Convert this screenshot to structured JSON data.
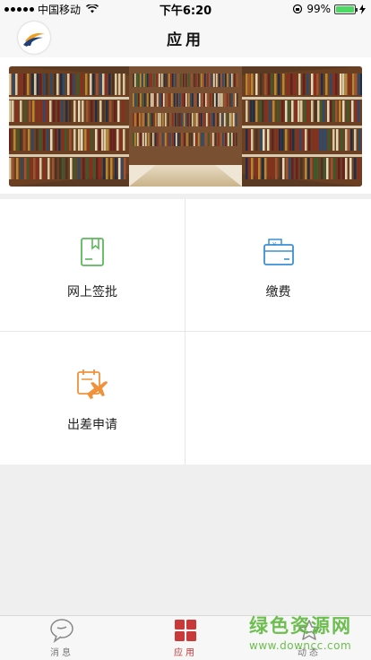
{
  "status_bar": {
    "carrier": "中国移动",
    "time": "下午6:20",
    "battery_percent": "99%",
    "battery_level": 0.99
  },
  "nav": {
    "title": "应用"
  },
  "apps": [
    {
      "label": "网上签批",
      "icon": "bookmark-document-icon",
      "color": "#5cb85c"
    },
    {
      "label": "缴费",
      "icon": "wallet-icon",
      "color": "#3a8fd6"
    },
    {
      "label": "出差申请",
      "icon": "airplane-calendar-icon",
      "color": "#f0923a"
    },
    {
      "label": "",
      "icon": "",
      "color": ""
    }
  ],
  "tabs": [
    {
      "label": "消息",
      "icon": "chat-bubble-icon",
      "active": false
    },
    {
      "label": "应用",
      "icon": "app-grid-icon",
      "active": true
    },
    {
      "label": "动态",
      "icon": "star-moments-icon",
      "active": false
    }
  ],
  "colors": {
    "active_tab": "#c9393a",
    "background": "#efefef"
  },
  "watermark": {
    "title": "绿色资源网",
    "url": "www.downcc.com"
  }
}
